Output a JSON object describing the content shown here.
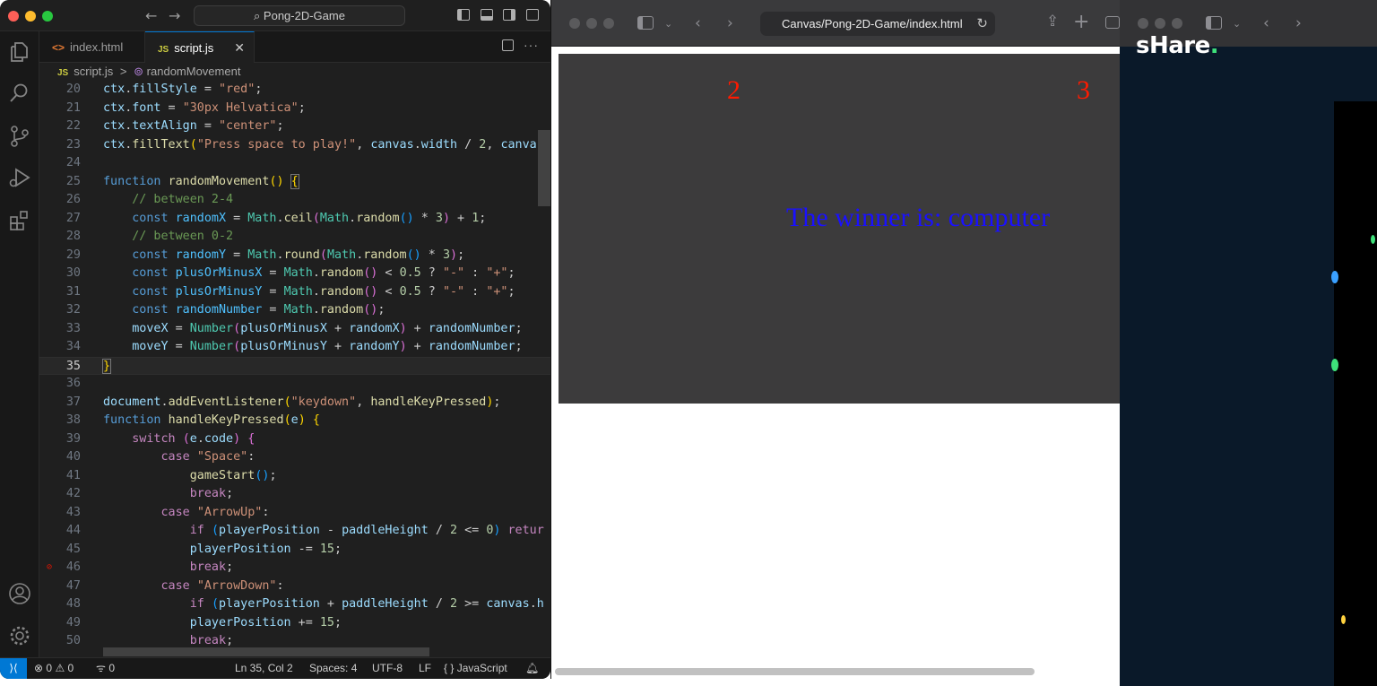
{
  "vscode": {
    "title_search": "Pong-2D-Game",
    "tabs": [
      {
        "label": "index.html",
        "icon": "html-file-icon"
      },
      {
        "label": "script.js",
        "icon": "js-file-icon",
        "active": true,
        "close": "✕"
      }
    ],
    "file_icons": {
      "html": "<>",
      "js": "JS"
    },
    "breadcrumb": {
      "file": "script.js",
      "separator": ">",
      "symbol": "randomMovement"
    },
    "code_lines": [
      20,
      21,
      22,
      23,
      24,
      25,
      26,
      27,
      28,
      29,
      30,
      31,
      32,
      33,
      34,
      35,
      36,
      37,
      38,
      39,
      40,
      41,
      42,
      43,
      44,
      45,
      46,
      47,
      48,
      49,
      50
    ],
    "current_line": 35,
    "breakpoint_line": 46,
    "statusbar": {
      "errors": "0",
      "warnings": "0",
      "ports": "0",
      "cursor": "Ln 35, Col 2",
      "spaces": "Spaces: 4",
      "encoding": "UTF-8",
      "eol": "LF",
      "language_icon": "{ }",
      "language": "JavaScript"
    }
  },
  "safari": {
    "address": "Canvas/Pong-2D-Game/index.html",
    "game": {
      "score_left": "2",
      "score_right": "3",
      "message": "The winner is: computer"
    }
  },
  "right_window": {
    "logo": "sHare",
    "logo_dot": "."
  },
  "colors": {
    "vscode_bg": "#1e1e1e",
    "canvas_bg": "#3c3b3c",
    "score_color": "#ff1a00",
    "winner_color": "#1a10ff",
    "accent": "#0078d4"
  }
}
